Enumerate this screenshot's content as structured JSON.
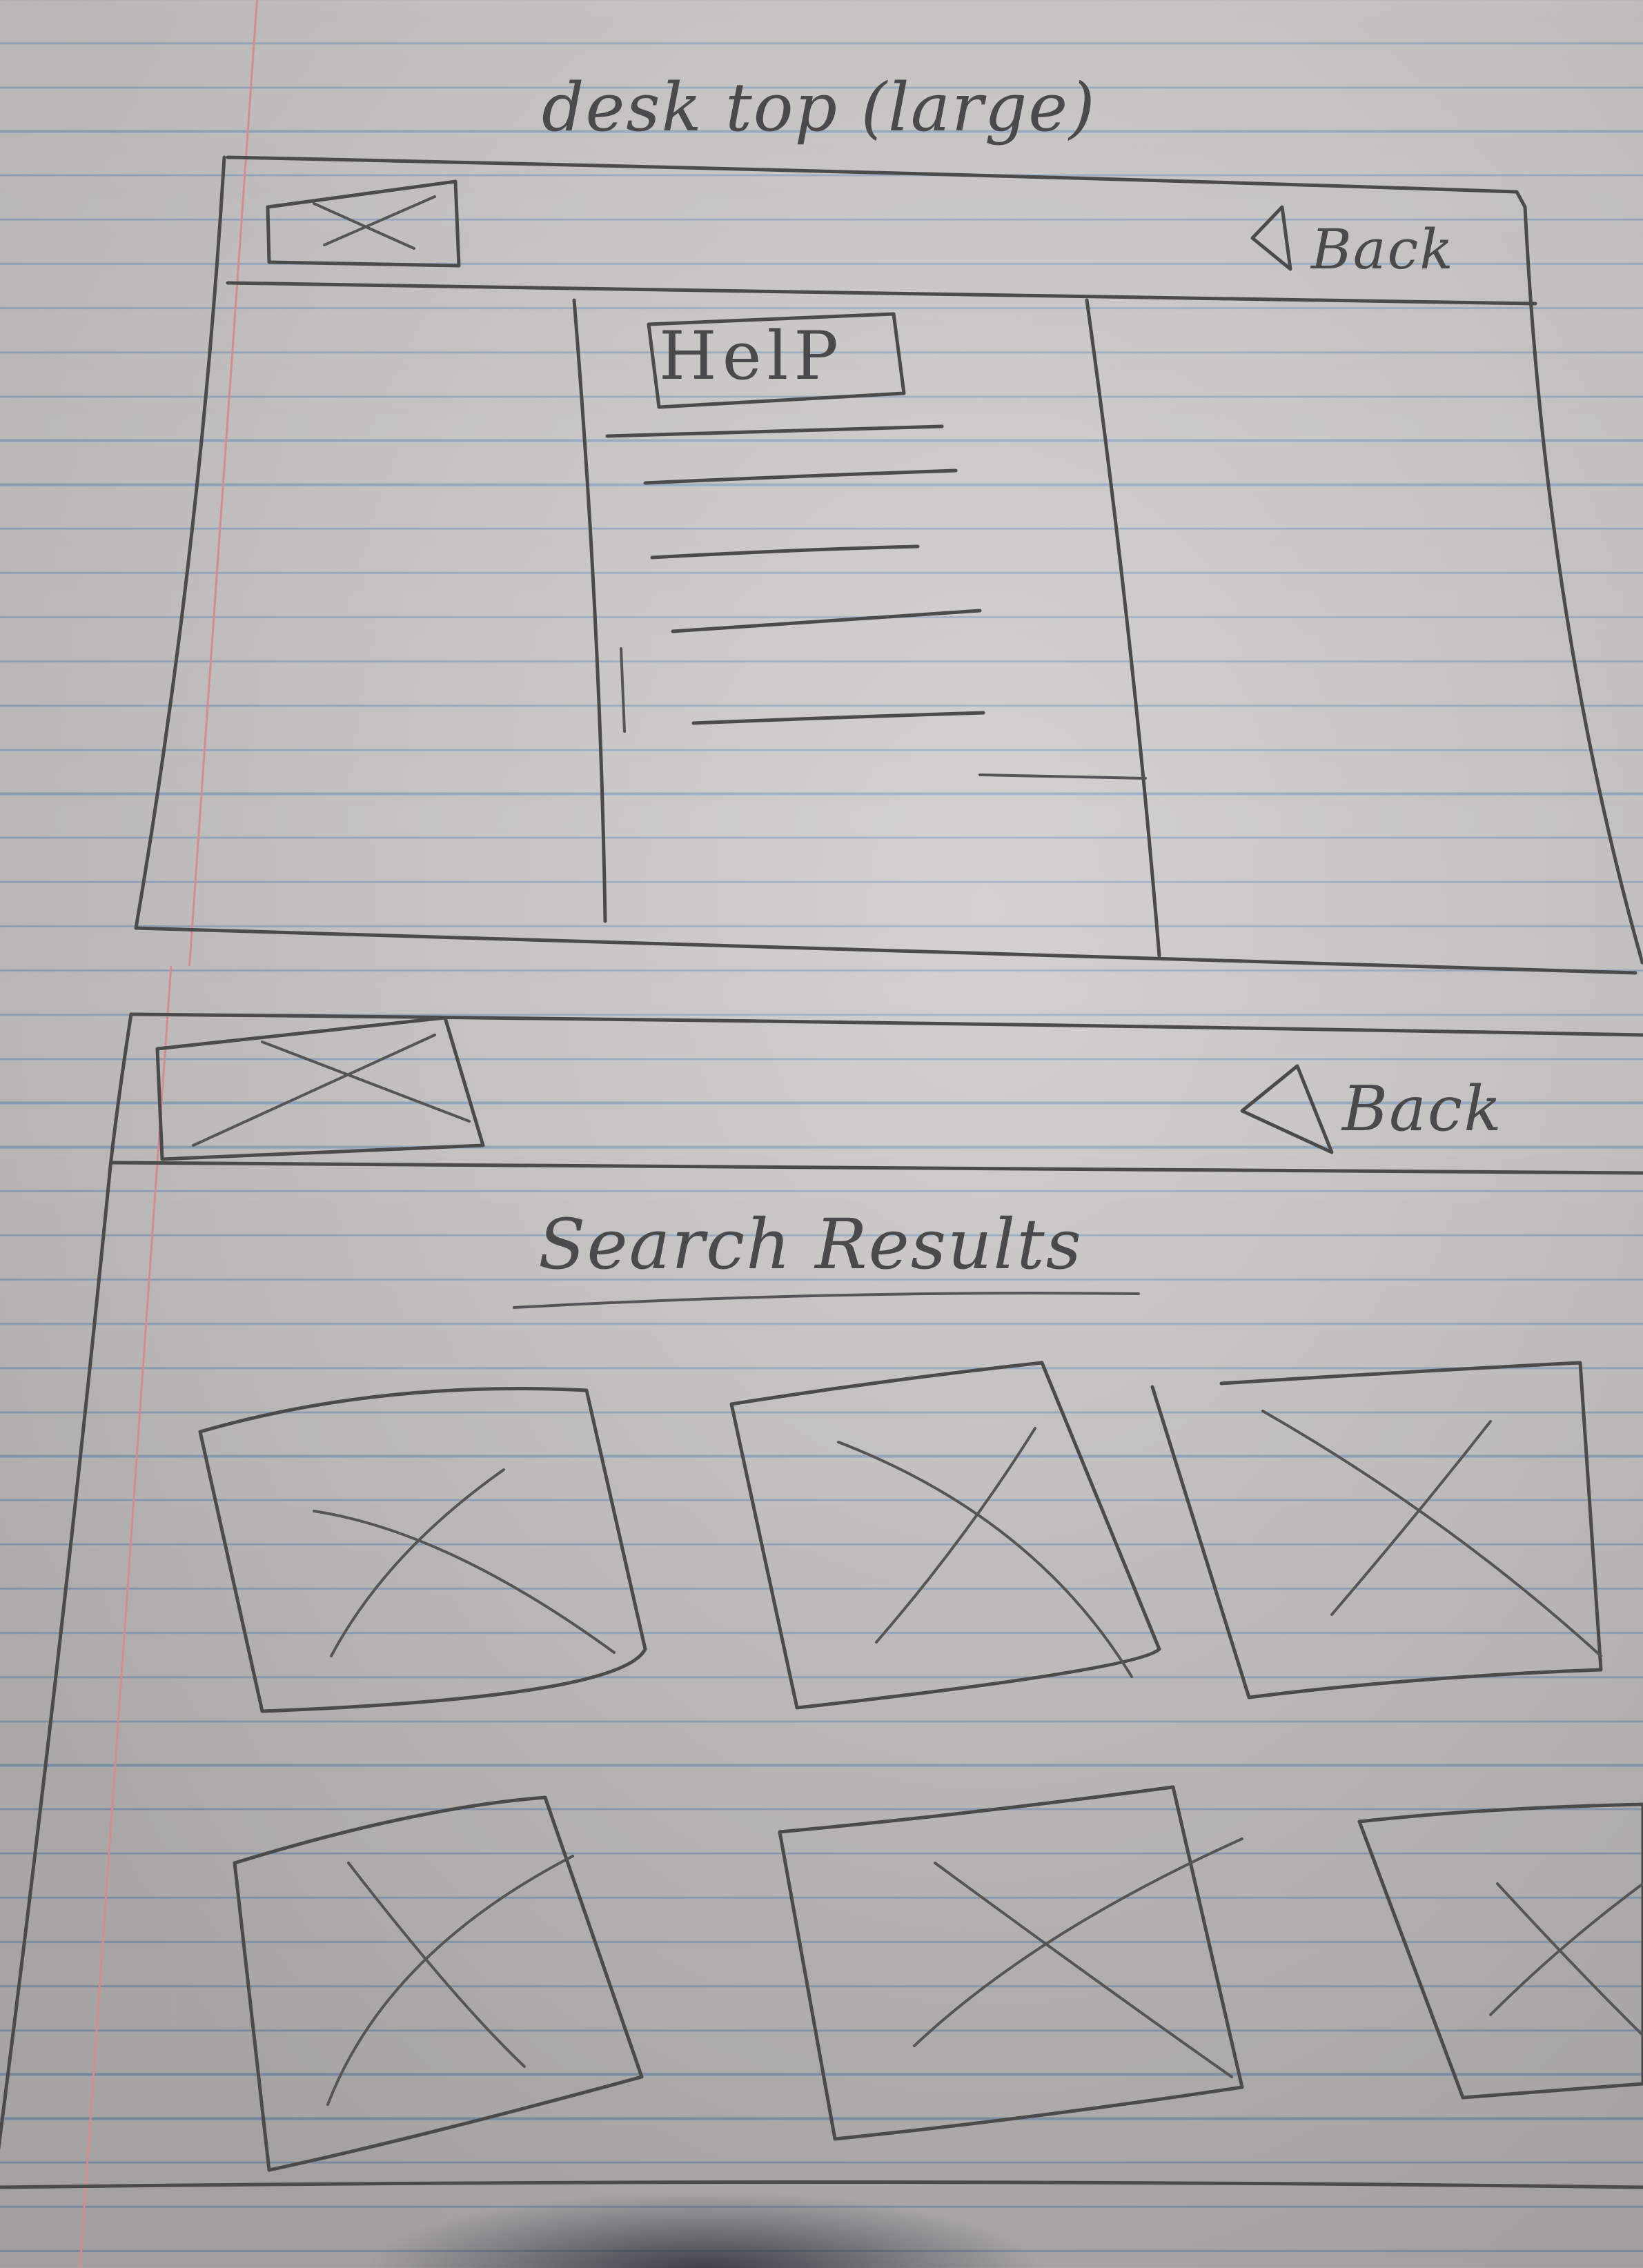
{
  "sheet_title": "desk top (large)",
  "wireframe_top": {
    "logo_placeholder": "image-placeholder",
    "back_label": "Back",
    "back_icon": "triangle-left-icon",
    "help_button_label": "HelP",
    "help_menu_lines": 6
  },
  "wireframe_bottom": {
    "logo_placeholder": "image-placeholder",
    "back_label": "Back",
    "back_icon": "triangle-left-icon",
    "results_heading": "Search Results",
    "result_tiles": 6
  },
  "colors": {
    "paper": "#c9c7c5",
    "rule_line": "#8fa6c2",
    "margin_line": "#d88a94",
    "pencil": "#4c4b4c"
  }
}
